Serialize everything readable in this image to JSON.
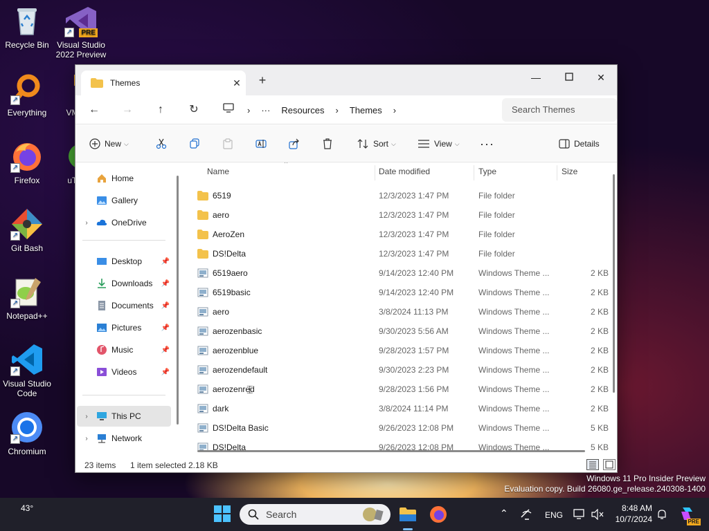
{
  "desktop": {
    "icons": [
      {
        "name": "recycle-bin",
        "label": "Recycle Bin"
      },
      {
        "name": "visual-studio-2022-preview",
        "label": "Visual Studio 2022 Preview",
        "badge": "PRE"
      },
      {
        "name": "everything",
        "label": "Everything"
      },
      {
        "name": "vmware-workstation",
        "label": "VM Wor"
      },
      {
        "name": "firefox",
        "label": "Firefox"
      },
      {
        "name": "utorrent",
        "label": "uTorr"
      },
      {
        "name": "git-bash",
        "label": "Git Bash"
      },
      {
        "name": "notepad-plus-plus",
        "label": "Notepad++"
      },
      {
        "name": "visual-studio-code",
        "label": "Visual Studio Code"
      },
      {
        "name": "chromium",
        "label": "Chromium"
      }
    ]
  },
  "window": {
    "tab_title": "Themes",
    "breadcrumbs": [
      "Resources",
      "Themes"
    ],
    "search_placeholder": "Search Themes",
    "toolbar": {
      "new_label": "New",
      "sort_label": "Sort",
      "view_label": "View",
      "details_label": "Details"
    },
    "navpane": {
      "quick": [
        {
          "label": "Home",
          "icon": "home-icon"
        },
        {
          "label": "Gallery",
          "icon": "gallery-icon"
        },
        {
          "label": "OneDrive",
          "icon": "cloud-icon",
          "expandable": true
        }
      ],
      "pinned": [
        {
          "label": "Desktop",
          "icon": "desktop-icon"
        },
        {
          "label": "Downloads",
          "icon": "download-icon"
        },
        {
          "label": "Documents",
          "icon": "document-icon"
        },
        {
          "label": "Pictures",
          "icon": "picture-icon"
        },
        {
          "label": "Music",
          "icon": "music-icon"
        },
        {
          "label": "Videos",
          "icon": "video-icon"
        }
      ],
      "drives": [
        {
          "label": "This PC",
          "icon": "computer-icon",
          "selected": true
        },
        {
          "label": "Network",
          "icon": "network-icon"
        }
      ]
    },
    "columns": {
      "name": "Name",
      "date": "Date modified",
      "type": "Type",
      "size": "Size"
    },
    "files": [
      {
        "name": "6519",
        "date": "12/3/2023 1:47 PM",
        "type": "File folder",
        "size": "",
        "kind": "folder"
      },
      {
        "name": "aero",
        "date": "12/3/2023 1:47 PM",
        "type": "File folder",
        "size": "",
        "kind": "folder"
      },
      {
        "name": "AeroZen",
        "date": "12/3/2023 1:47 PM",
        "type": "File folder",
        "size": "",
        "kind": "folder"
      },
      {
        "name": "DS!Delta",
        "date": "12/3/2023 1:47 PM",
        "type": "File folder",
        "size": "",
        "kind": "folder"
      },
      {
        "name": "6519aero",
        "date": "9/14/2023 12:40 PM",
        "type": "Windows Theme ...",
        "size": "2 KB",
        "kind": "theme"
      },
      {
        "name": "6519basic",
        "date": "9/14/2023 12:40 PM",
        "type": "Windows Theme ...",
        "size": "2 KB",
        "kind": "theme"
      },
      {
        "name": "aero",
        "date": "3/8/2024 11:13 PM",
        "type": "Windows Theme ...",
        "size": "2 KB",
        "kind": "theme"
      },
      {
        "name": "aerozenbasic",
        "date": "9/30/2023 5:56 AM",
        "type": "Windows Theme ...",
        "size": "2 KB",
        "kind": "theme"
      },
      {
        "name": "aerozenblue",
        "date": "9/28/2023 1:57 PM",
        "type": "Windows Theme ...",
        "size": "2 KB",
        "kind": "theme"
      },
      {
        "name": "aerozendefault",
        "date": "9/30/2023 2:23 PM",
        "type": "Windows Theme ...",
        "size": "2 KB",
        "kind": "theme"
      },
      {
        "name": "aerozenred",
        "date": "9/28/2023 1:56 PM",
        "type": "Windows Theme ...",
        "size": "2 KB",
        "kind": "theme"
      },
      {
        "name": "dark",
        "date": "3/8/2024 11:14 PM",
        "type": "Windows Theme ...",
        "size": "2 KB",
        "kind": "theme"
      },
      {
        "name": "DS!Delta Basic",
        "date": "9/26/2023 12:08 PM",
        "type": "Windows Theme ...",
        "size": "5 KB",
        "kind": "theme"
      },
      {
        "name": "DS!Delta",
        "date": "9/26/2023 12:08 PM",
        "type": "Windows Theme ...",
        "size": "5 KB",
        "kind": "theme"
      }
    ],
    "status": {
      "items": "23 items",
      "selection": "1 item selected",
      "size": "2.18 KB"
    }
  },
  "watermark": {
    "line1": "Windows 11 Pro Insider Preview",
    "line2": "Evaluation copy. Build 26080.ge_release.240308-1400"
  },
  "taskbar": {
    "weather": "43°",
    "search_placeholder": "Search",
    "language": "ENG",
    "time": "8:48 AM",
    "date": "10/7/2024",
    "copilot_badge": "PRE"
  },
  "colors": {
    "folder": "#f3c24b",
    "accent": "#0067c0",
    "taskbar": "#20202a"
  }
}
